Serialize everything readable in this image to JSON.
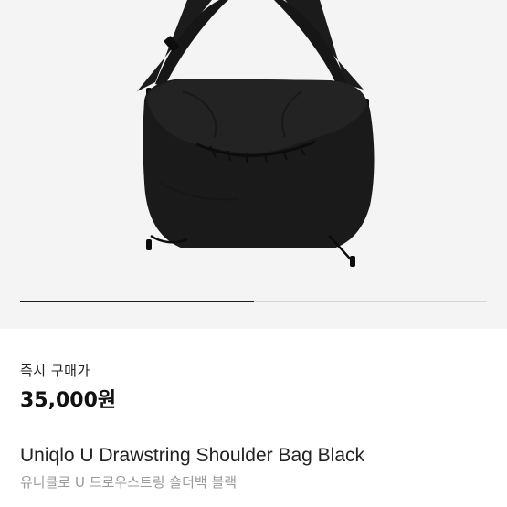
{
  "product": {
    "image_alt": "black drawstring shoulder bag",
    "carousel": {
      "current": 1,
      "total": 2
    },
    "purchase_type": "즉시 구매가",
    "price": "35,000원",
    "title": "Uniqlo U Drawstring Shoulder Bag Black",
    "subtitle": "유니클로 U 드로우스트링 숄더백 블랙"
  },
  "colors": {
    "hero_background": "#f4f4f4",
    "bag": "#1a1a1a",
    "indicator_active": "#1c1c1c",
    "indicator_track": "#d6d6d6",
    "subtitle_text": "#9a9a9a"
  }
}
